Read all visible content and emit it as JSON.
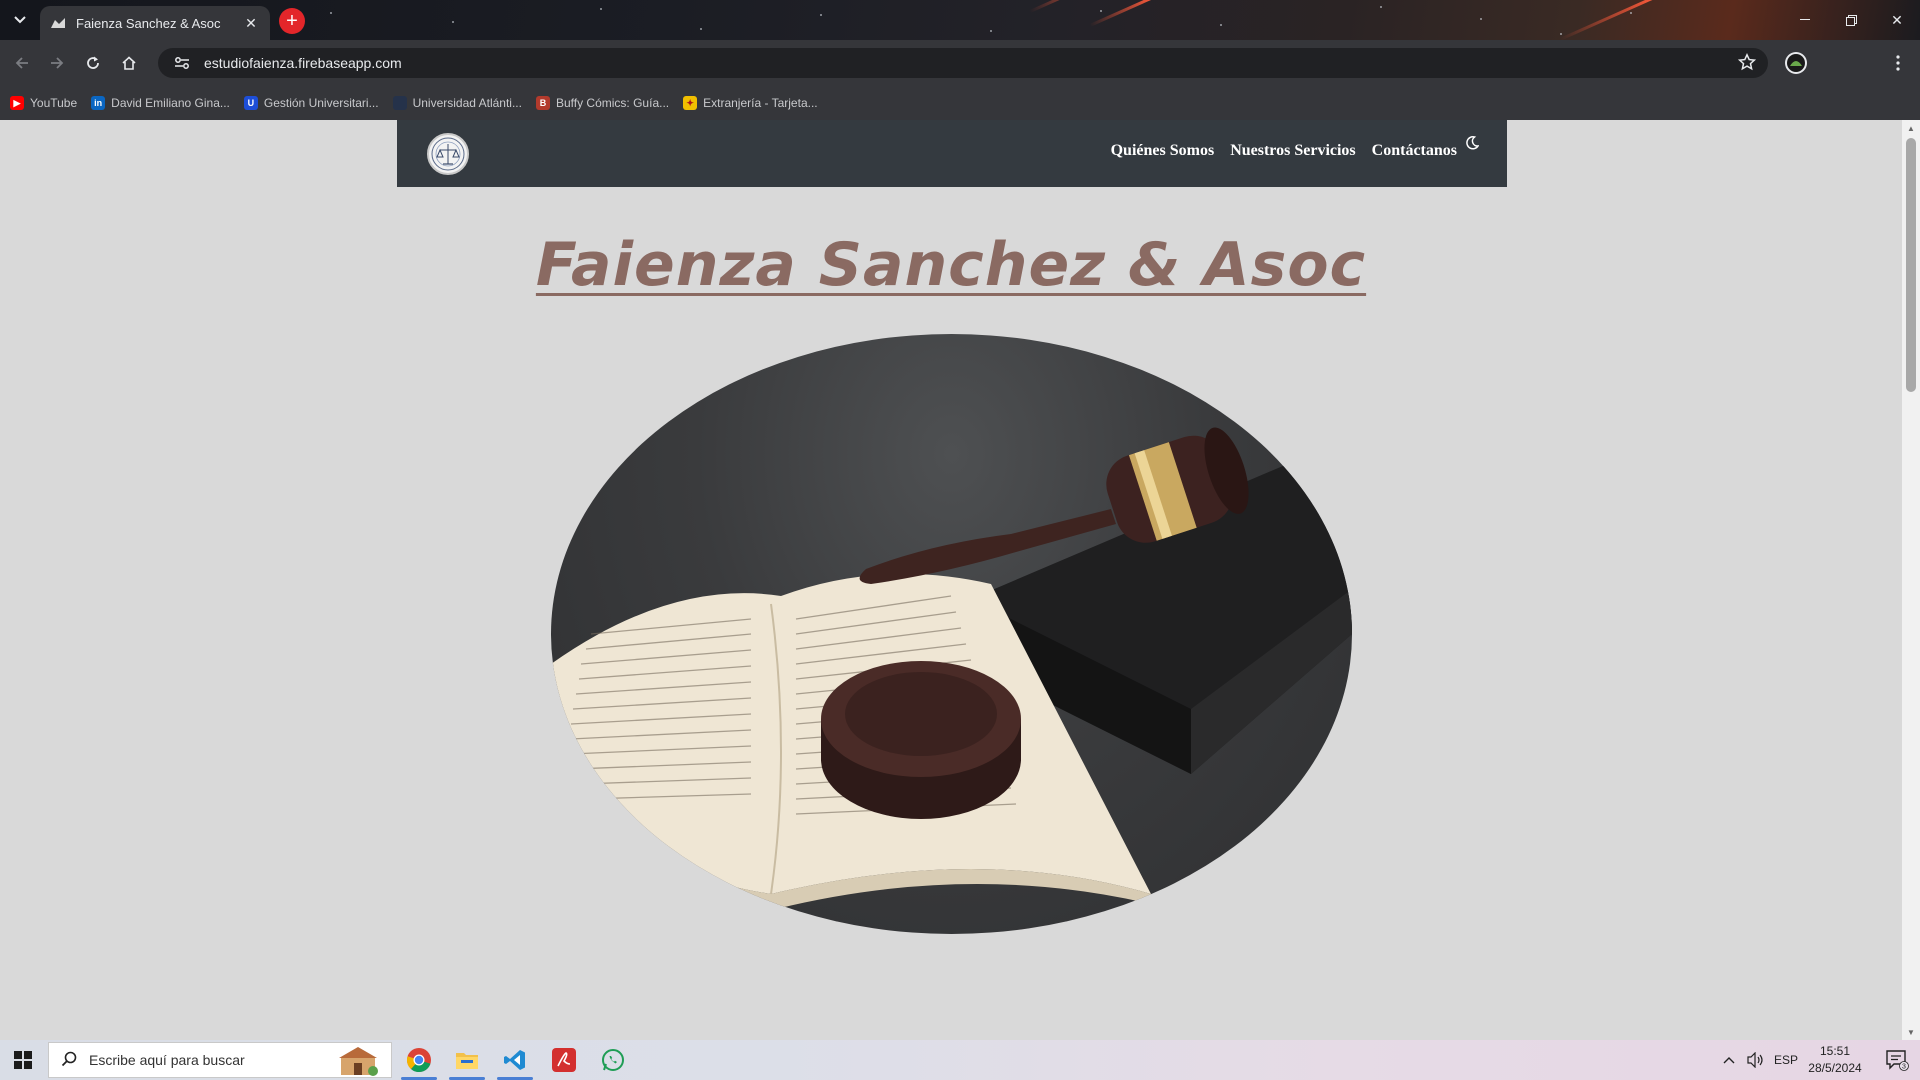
{
  "browser": {
    "tab": {
      "title": "Faienza Sanchez & Asoc"
    },
    "address": "estudiofaienza.firebaseapp.com",
    "bookmarks": [
      {
        "label": "YouTube",
        "icon": "youtube-icon",
        "color": "#ff0000"
      },
      {
        "label": "David Emiliano Gina...",
        "icon": "linkedin-icon",
        "color": "#0a66c2"
      },
      {
        "label": "Gestión Universitari...",
        "icon": "university-icon",
        "color": "#1d4ed8"
      },
      {
        "label": "Universidad Atlánti...",
        "icon": "atlantida-icon",
        "color": "#25324a"
      },
      {
        "label": "Buffy Cómics: Guía...",
        "icon": "buffy-icon",
        "color": "#b23a2c"
      },
      {
        "label": "Extranjería - Tarjeta...",
        "icon": "spain-icon",
        "color": "#f1bf00"
      }
    ]
  },
  "site": {
    "nav": {
      "links": [
        "Quiénes Somos",
        "Nuestros Servicios",
        "Contáctanos"
      ],
      "theme_icon": "moon-icon"
    },
    "hero": {
      "title": "Faienza Sanchez & Asoc",
      "image": "gavel-on-law-book-image"
    },
    "colors": {
      "nav_bg": "#343a40",
      "title": "#8a6a62",
      "page_bg": "#d9d9d9"
    }
  },
  "taskbar": {
    "search_placeholder": "Escribe aquí para buscar",
    "apps": [
      "chrome-icon",
      "file-explorer-icon",
      "vscode-icon",
      "acrobat-icon",
      "whatsapp-icon"
    ],
    "language": "ESP",
    "time": "15:51",
    "date": "28/5/2024",
    "notifications": "3"
  }
}
